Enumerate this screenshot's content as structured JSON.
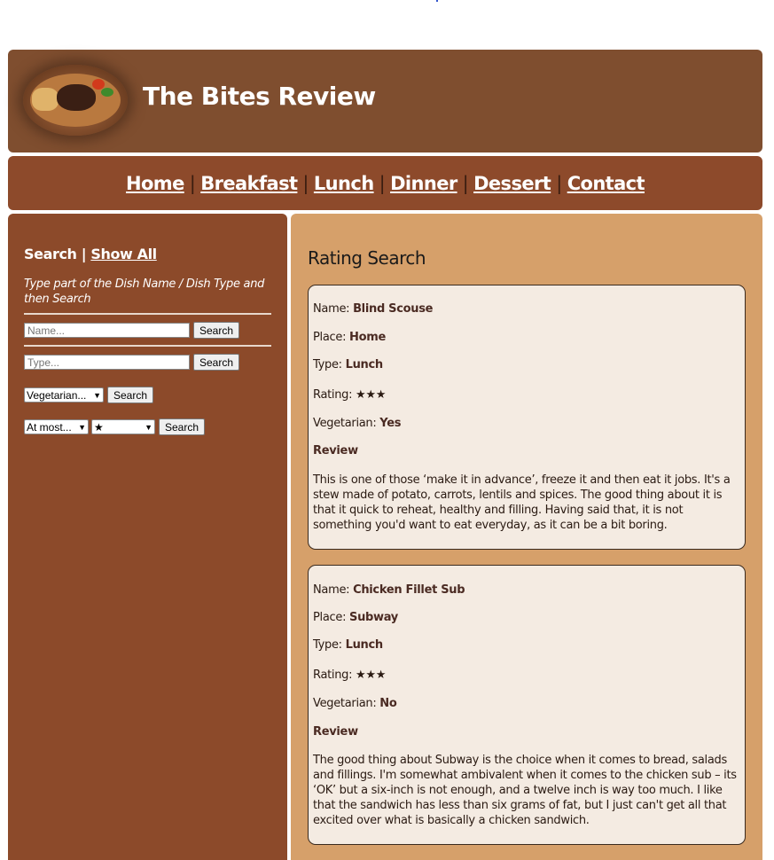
{
  "site": {
    "title": "The Bites Review"
  },
  "nav": {
    "items": [
      {
        "label": "Home"
      },
      {
        "label": "Breakfast"
      },
      {
        "label": "Lunch"
      },
      {
        "label": "Dinner"
      },
      {
        "label": "Dessert"
      },
      {
        "label": "Contact"
      }
    ],
    "separator": "|"
  },
  "sidebar": {
    "search_label": "Search",
    "separator": "|",
    "show_all_label": "Show All",
    "hint": "Type part of the Dish Name / Dish Type and then Search",
    "name_placeholder": "Name...",
    "type_placeholder": "Type...",
    "search_button": "Search",
    "vegetarian_select": "Vegetarian...",
    "rating_compare_select": "At most...",
    "rating_value_select": "★"
  },
  "main": {
    "title": "Rating Search",
    "labels": {
      "name": "Name:",
      "place": "Place:",
      "type": "Type:",
      "rating": "Rating:",
      "vegetarian": "Vegetarian:",
      "review": "Review"
    },
    "reviews": [
      {
        "name": "Blind Scouse",
        "place": "Home",
        "type": "Lunch",
        "rating": "★★★",
        "vegetarian": "Yes",
        "review": "This is one of those ‘make it in advance’, freeze it and then eat it jobs. It's a stew made of potato, carrots, lentils and spices. The good thing about it is that it quick to reheat, healthy and filling. Having said that, it is not something you'd want to eat everyday, as it can be a bit boring."
      },
      {
        "name": "Chicken Fillet Sub",
        "place": "Subway",
        "type": "Lunch",
        "rating": "★★★",
        "vegetarian": "No",
        "review": "The good thing about Subway is the choice when it comes to bread, salads and fillings. I'm somewhat ambivalent when it comes to the chicken sub – its ‘OK’ but a six-inch is not enough, and a twelve inch is way too much. I like that the sandwich has less than six grams of fat, but I just can't get all that excited over what is basically a chicken sandwich."
      }
    ]
  },
  "colors": {
    "header_bg": "#7f4e2f",
    "nav_bg": "#8d4a2b",
    "sidebar_bg": "#8c4a2a",
    "main_bg": "#d6a06a",
    "card_bg": "#f4ebe2"
  }
}
